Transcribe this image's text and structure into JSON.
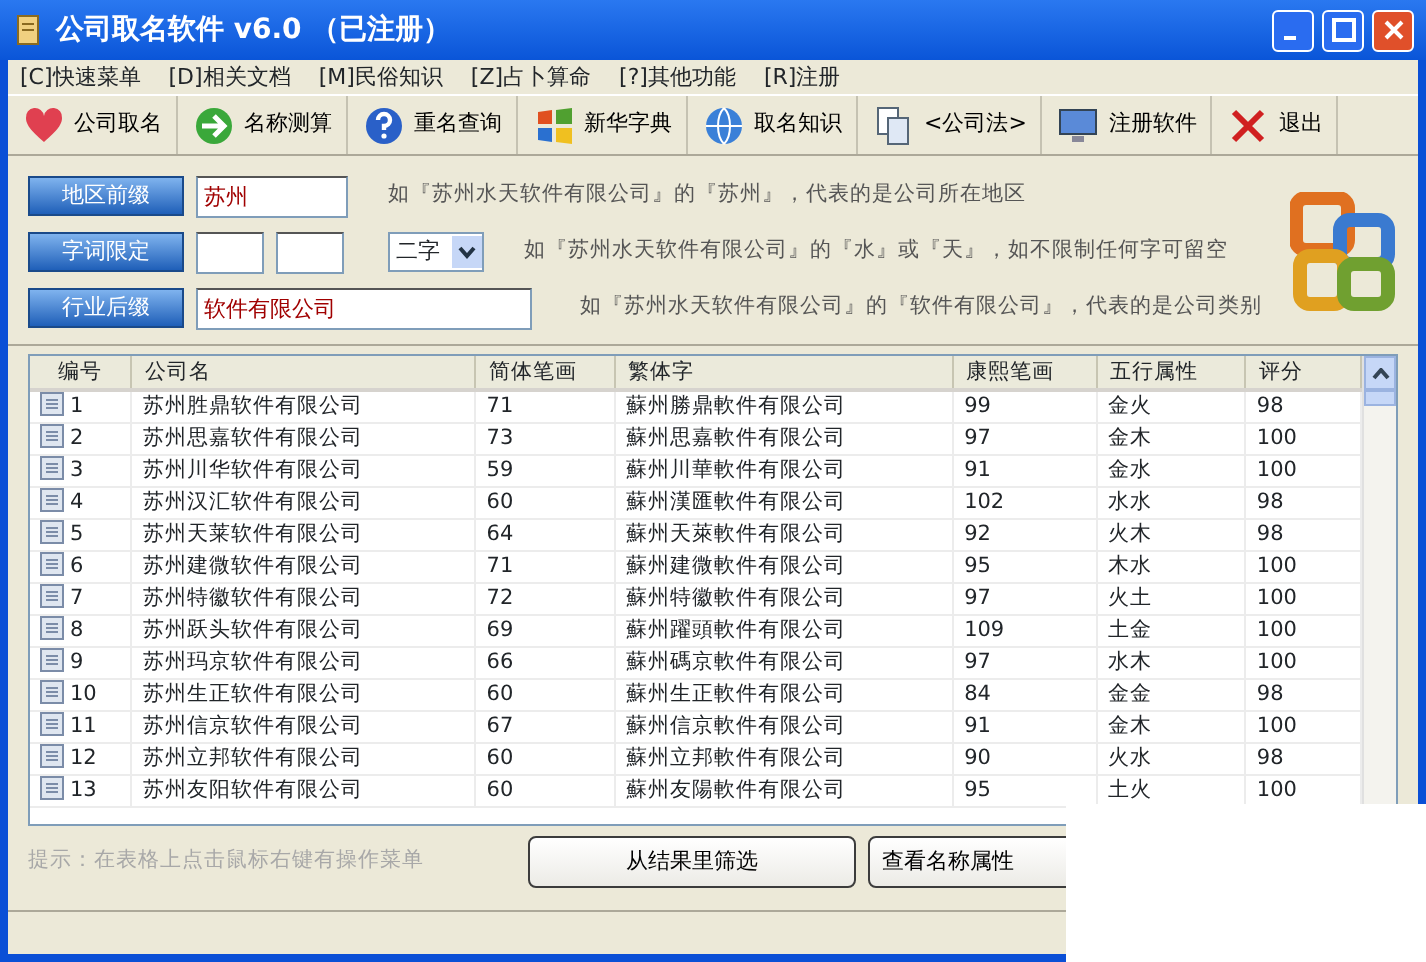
{
  "window": {
    "title": "公司取名软件 v6.0 （已注册）"
  },
  "menu": [
    "[C]快速菜单",
    "[D]相关文档",
    "[M]民俗知识",
    "[Z]占卜算命",
    "[?]其他功能",
    "[R]注册"
  ],
  "toolbar": [
    "公司取名",
    "名称测算",
    "重名查询",
    "新华字典",
    "取名知识",
    "<公司法>",
    "注册软件",
    "退出"
  ],
  "form": {
    "region": {
      "button": "地区前缀",
      "value": "苏州",
      "hint": "如『苏州水天软件有限公司』的『苏州』，代表的是公司所在地区"
    },
    "words": {
      "button": "字词限定",
      "select": "二字",
      "hint": "如『苏州水天软件有限公司』的『水』或『天』，如不限制任何字可留空"
    },
    "industry": {
      "button": "行业后缀",
      "value": "软件有限公司",
      "hint": "如『苏州水天软件有限公司』的『软件有限公司』，代表的是公司类别"
    }
  },
  "table": {
    "columns": [
      "编号",
      "公司名",
      "简体笔画",
      "繁体字",
      "康熙笔画",
      "五行属性",
      "评分"
    ],
    "rows": [
      [
        "1",
        "苏州胜鼎软件有限公司",
        "71",
        "蘇州勝鼎軟件有限公司",
        "99",
        "金火",
        "98"
      ],
      [
        "2",
        "苏州思嘉软件有限公司",
        "73",
        "蘇州思嘉軟件有限公司",
        "97",
        "金木",
        "100"
      ],
      [
        "3",
        "苏州川华软件有限公司",
        "59",
        "蘇州川華軟件有限公司",
        "91",
        "金水",
        "100"
      ],
      [
        "4",
        "苏州汉汇软件有限公司",
        "60",
        "蘇州漢匯軟件有限公司",
        "102",
        "水水",
        "98"
      ],
      [
        "5",
        "苏州天莱软件有限公司",
        "64",
        "蘇州天萊軟件有限公司",
        "92",
        "火木",
        "98"
      ],
      [
        "6",
        "苏州建微软件有限公司",
        "71",
        "蘇州建微軟件有限公司",
        "95",
        "木水",
        "100"
      ],
      [
        "7",
        "苏州特徽软件有限公司",
        "72",
        "蘇州特徽軟件有限公司",
        "97",
        "火土",
        "100"
      ],
      [
        "8",
        "苏州跃头软件有限公司",
        "69",
        "蘇州躍頭軟件有限公司",
        "109",
        "土金",
        "100"
      ],
      [
        "9",
        "苏州玛京软件有限公司",
        "66",
        "蘇州碼京軟件有限公司",
        "97",
        "水木",
        "100"
      ],
      [
        "10",
        "苏州生正软件有限公司",
        "60",
        "蘇州生正軟件有限公司",
        "84",
        "金金",
        "98"
      ],
      [
        "11",
        "苏州信京软件有限公司",
        "67",
        "蘇州信京軟件有限公司",
        "91",
        "金木",
        "100"
      ],
      [
        "12",
        "苏州立邦软件有限公司",
        "60",
        "蘇州立邦軟件有限公司",
        "90",
        "火水",
        "98"
      ],
      [
        "13",
        "苏州友阳软件有限公司",
        "60",
        "蘇州友陽軟件有限公司",
        "95",
        "土火",
        "100"
      ]
    ]
  },
  "hint": "提示：在表格上点击鼠标右键有操作菜单",
  "buttons": [
    "从结果里筛选",
    "查看名称属性"
  ]
}
